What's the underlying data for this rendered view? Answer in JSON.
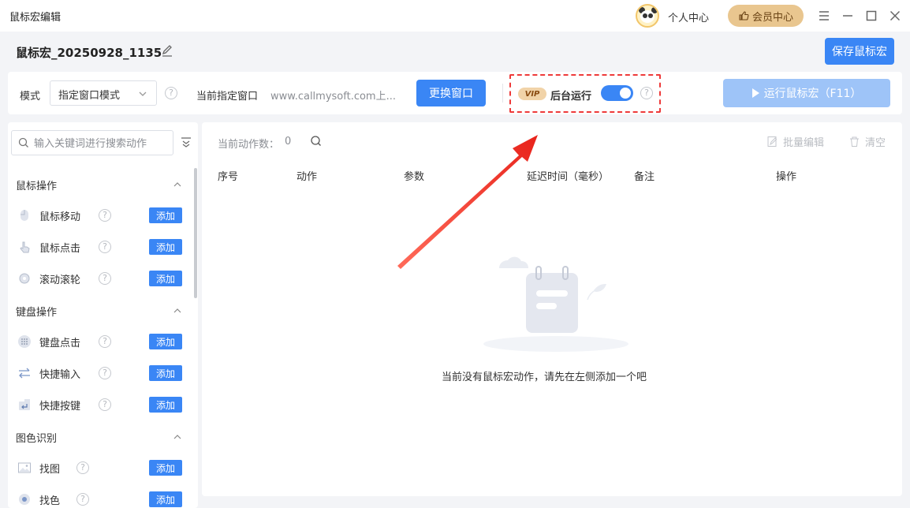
{
  "window": {
    "title": "鼠标宏编辑",
    "personal_center": "个人中心",
    "vip_center": "会员中心"
  },
  "macro": {
    "name": "鼠标宏_20250928_1135",
    "save_label": "保存鼠标宏"
  },
  "toolbar": {
    "mode_label": "模式",
    "mode_value": "指定窗口模式",
    "current_window_label": "当前指定窗口",
    "current_window_value": "www.callmysoft.com上...",
    "change_window_label": "更换窗口",
    "vip_badge": "VIP",
    "background_run_label": "后台运行",
    "background_run_enabled": true,
    "run_label": "运行鼠标宏（F11）"
  },
  "sidebar": {
    "search_placeholder": "输入关键词进行搜索动作",
    "add_label": "添加",
    "sections": [
      {
        "title": "鼠标操作",
        "items": [
          {
            "label": "鼠标移动",
            "icon": "mouse-icon"
          },
          {
            "label": "鼠标点击",
            "icon": "pointer-click-icon"
          },
          {
            "label": "滚动滚轮",
            "icon": "gear-icon"
          }
        ]
      },
      {
        "title": "键盘操作",
        "items": [
          {
            "label": "键盘点击",
            "icon": "keypad-icon"
          },
          {
            "label": "快捷输入",
            "icon": "swap-arrows-icon"
          },
          {
            "label": "快捷按键",
            "icon": "enter-key-icon"
          }
        ]
      },
      {
        "title": "图色识别",
        "items": [
          {
            "label": "找图",
            "icon": "image-icon"
          },
          {
            "label": "找色",
            "icon": "color-picker-icon"
          }
        ]
      }
    ]
  },
  "main": {
    "count_label": "当前动作数：",
    "count_value": "0",
    "batch_edit_label": "批量编辑",
    "clear_label": "清空",
    "columns": [
      "序号",
      "动作",
      "参数",
      "延迟时间（毫秒）",
      "备注",
      "操作"
    ],
    "empty_text": "当前没有鼠标宏动作，请先在左侧添加一个吧"
  },
  "colors": {
    "primary": "#3a86f5",
    "primary_disabled": "#9ec4f8",
    "vip_gold": "#e9c68f",
    "annotation_red": "#ee3a3a"
  }
}
